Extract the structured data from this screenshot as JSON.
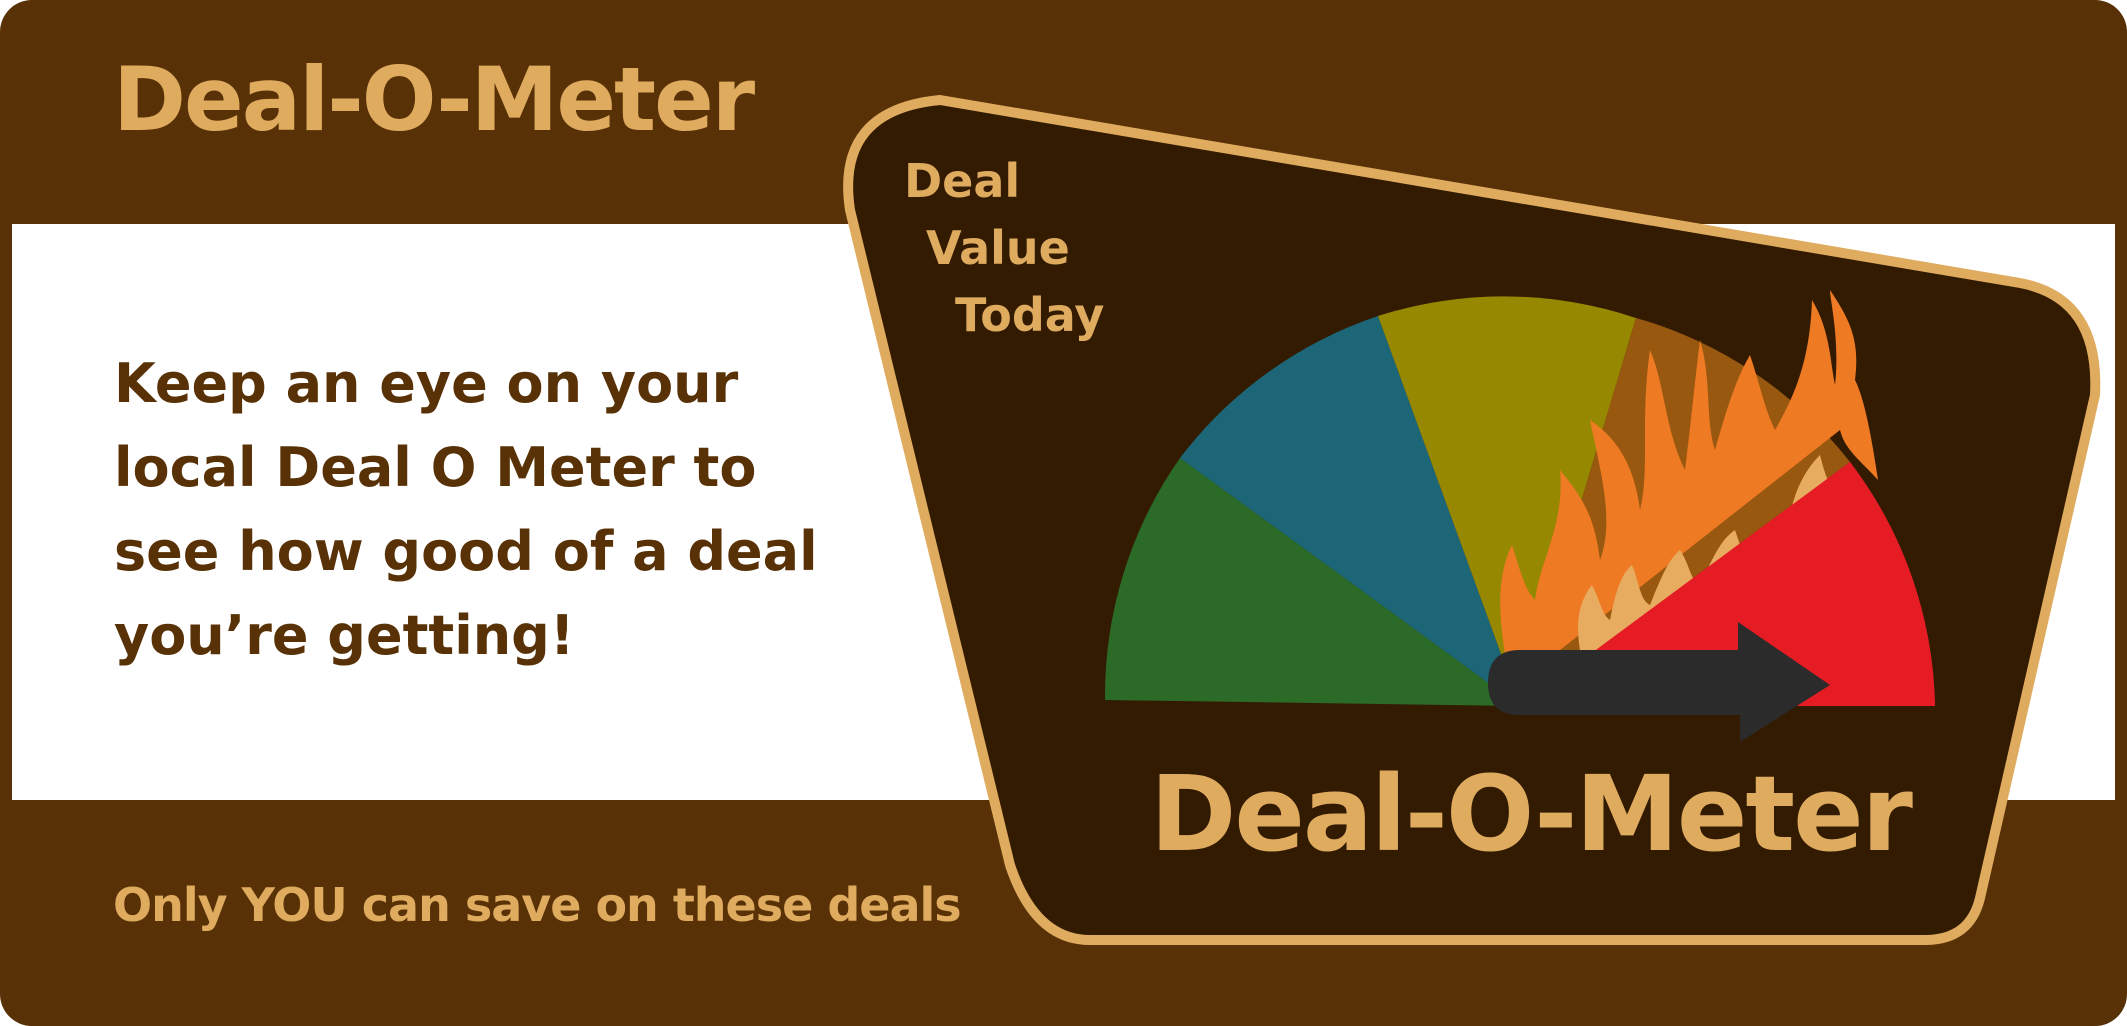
{
  "banner": {
    "title": "Deal-O-Meter",
    "message_part1": "Keep an eye on your local ",
    "message_brand": "Deal O Meter",
    "message_part2": " to see how good of a deal you’re getting!",
    "tagline": "Only YOU can save on these deals"
  },
  "sign": {
    "label_lines": [
      "Deal",
      "Value",
      "Today"
    ],
    "title": "Deal-O-Meter",
    "gauge_level": "highest (red segment)"
  },
  "colors": {
    "brown": "#583106",
    "dark_brown": "#331b02",
    "tan": "#dfab5f",
    "segment_green": "#2b6a27",
    "segment_blue": "#1c6678",
    "segment_olive": "#978802",
    "segment_orange": "#99580f",
    "segment_red": "#e51c24",
    "needle": "#2b2b2b",
    "flame_orange": "#ee7a23",
    "flame_light": "#e8ac61"
  },
  "icons": {
    "gauge": "speedometer-gauge",
    "needle": "arrow-needle-icon",
    "fire": "flame-icon"
  }
}
